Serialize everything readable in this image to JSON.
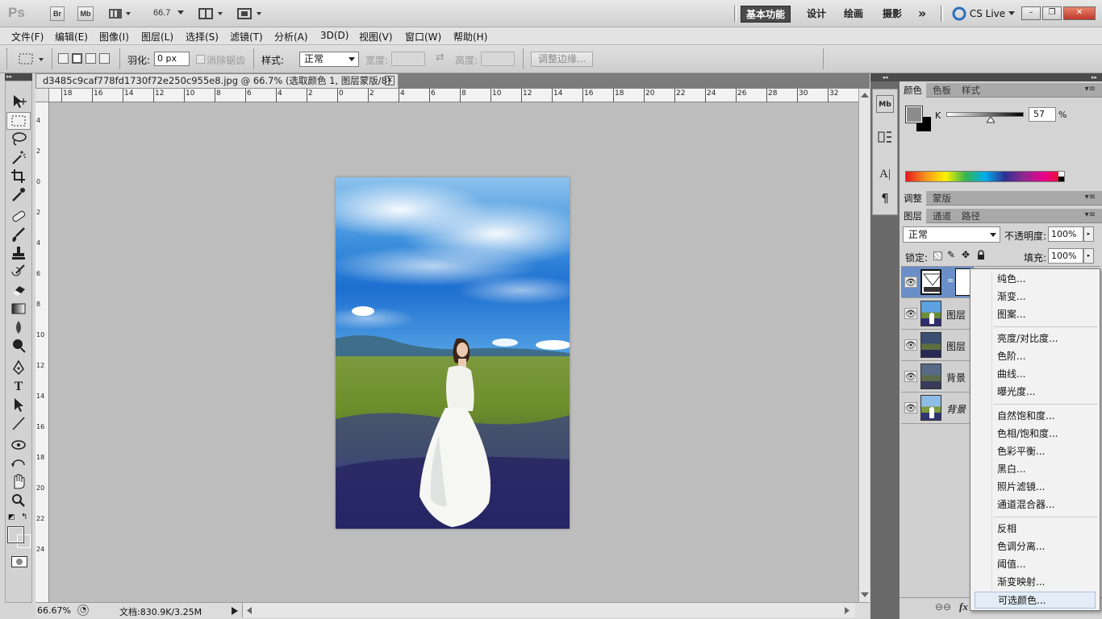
{
  "app": {
    "logo": "Ps",
    "br_label": "Br",
    "mb_label": "Mb",
    "zoom_value": "66.7",
    "workspaces": [
      "基本功能",
      "设计",
      "绘画",
      "摄影"
    ],
    "more_label": "»",
    "cslive_label": "CS Live",
    "window_min": "–",
    "window_restore": "❐",
    "window_close": "✕"
  },
  "menubar": {
    "items": [
      "文件(F)",
      "编辑(E)",
      "图像(I)",
      "图层(L)",
      "选择(S)",
      "滤镜(T)",
      "分析(A)",
      "3D(D)",
      "视图(V)",
      "窗口(W)",
      "帮助(H)"
    ]
  },
  "options": {
    "feather_label": "羽化:",
    "feather_value": "0 px",
    "antialias_label": "消除锯齿",
    "style_label": "样式:",
    "style_value": "正常",
    "width_label": "宽度:",
    "height_label": "高度:",
    "refine_edge_label": "调整边缘..."
  },
  "document": {
    "tab_title": "d3485c9caf778fd1730f72e250c955e8.jpg @ 66.7% (选取颜色 1, 图层蒙版/8) *",
    "ruler_top_labels": [
      "18",
      "16",
      "14",
      "12",
      "10",
      "8",
      "6",
      "4",
      "2",
      "0",
      "2",
      "4",
      "6",
      "8",
      "10",
      "12",
      "14",
      "16",
      "18",
      "20",
      "22",
      "24",
      "26",
      "28",
      "30",
      "32"
    ],
    "ruler_left_labels": [
      "4",
      "2",
      "0",
      "2",
      "4",
      "6",
      "8",
      "10",
      "12",
      "14",
      "16",
      "18",
      "20",
      "22",
      "24"
    ],
    "status_zoom": "66.67%",
    "status_doc": "文档:830.9K/3.25M"
  },
  "color_panel": {
    "tabs": [
      "颜色",
      "色板",
      "样式"
    ],
    "channel_label": "K",
    "value": "57",
    "unit": "%",
    "slider_fraction": 0.57
  },
  "adjust_panel": {
    "tabs": [
      "调整",
      "蒙版"
    ]
  },
  "layers_panel": {
    "tabs": [
      "图层",
      "通道",
      "路径"
    ],
    "blend_mode": "正常",
    "opacity_label": "不透明度:",
    "opacity_value": "100%",
    "lock_label": "锁定:",
    "fill_label": "填充:",
    "fill_value": "100%",
    "rows": [
      {
        "name": ""
      },
      {
        "name": "图层"
      },
      {
        "name": "图层"
      },
      {
        "name": "背景"
      },
      {
        "name": "背景"
      }
    ],
    "fx_label": "fx"
  },
  "context_menu": {
    "groups": [
      [
        "纯色...",
        "渐变...",
        "图案..."
      ],
      [
        "亮度/对比度...",
        "色阶...",
        "曲线...",
        "曝光度..."
      ],
      [
        "自然饱和度...",
        "色相/饱和度...",
        "色彩平衡...",
        "黑白...",
        "照片滤镜...",
        "通道混合器..."
      ],
      [
        "反相",
        "色调分离...",
        "阈值...",
        "渐变映射...",
        "可选颜色..."
      ]
    ],
    "highlighted": "可选颜色..."
  },
  "colors": {
    "foreground": "#8c8c8c",
    "background": "#000000",
    "active_workspace": "#4a4a4a"
  }
}
